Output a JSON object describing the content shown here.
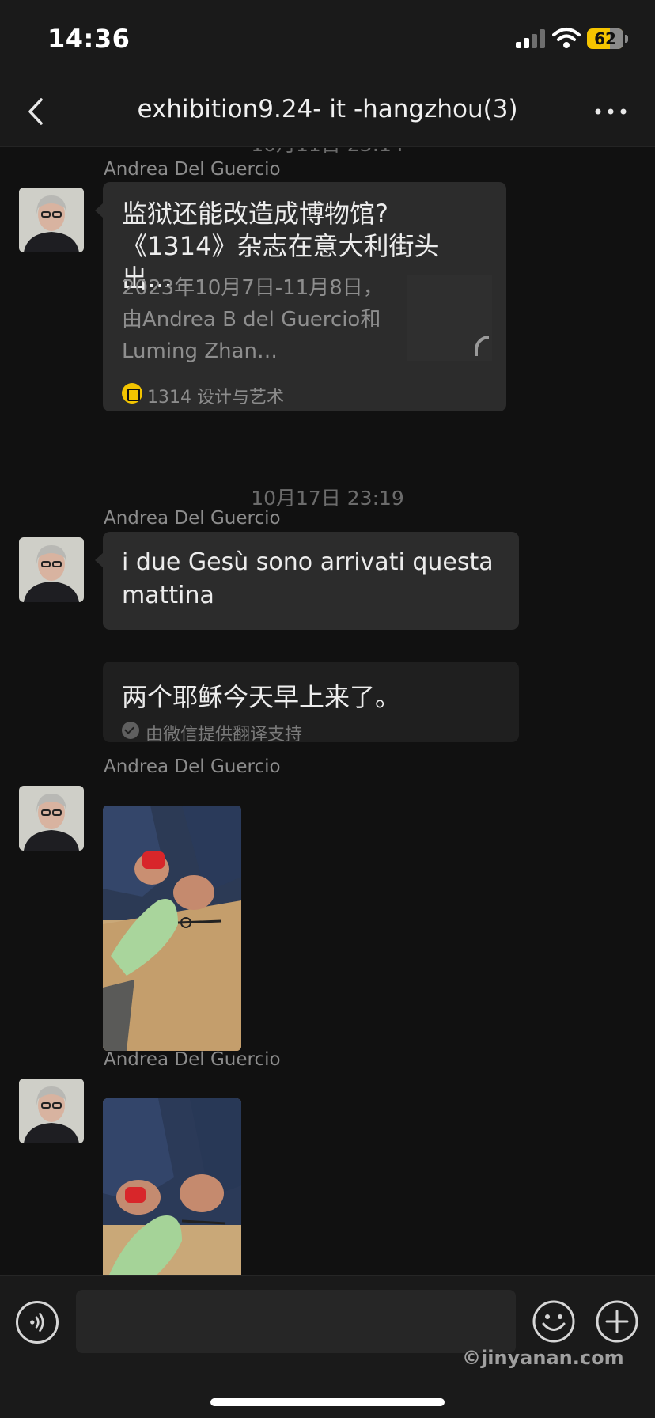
{
  "status_bar": {
    "time": "14:36",
    "battery_level": "62",
    "battery_fraction": 0.62
  },
  "nav": {
    "title": "exhibition9.24- it -hangzhou(3)",
    "back_icon": "chevron-left-icon",
    "more_icon": "ellipsis-icon"
  },
  "messages": {
    "timestamp_1": "10月11日 23:14",
    "timestamp_2": "10月17日 23:19",
    "sender_1": "Andrea Del Guercio",
    "sender_2": "Andrea Del Guercio",
    "sender_3": "Andrea Del Guercio",
    "sender_4": "Andrea Del Guercio",
    "link_card": {
      "title": "监狱还能改造成博物馆?《1314》杂志在意大利街头出…",
      "description": "2023年10月7日-11月8日，由Andrea B del Guercio和Luming Zhan…",
      "source": "1314 设计与艺术"
    },
    "text_message": "i due Gesù sono arrivati questa mattina",
    "translation": {
      "text": "两个耶稣今天早上来了。",
      "note": "由微信提供翻译支持"
    }
  },
  "input_bar": {
    "placeholder": "",
    "voice_icon": "voice-icon",
    "emoji_icon": "emoji-icon",
    "plus_icon": "plus-icon"
  },
  "watermark": "©jinyanan.com"
}
